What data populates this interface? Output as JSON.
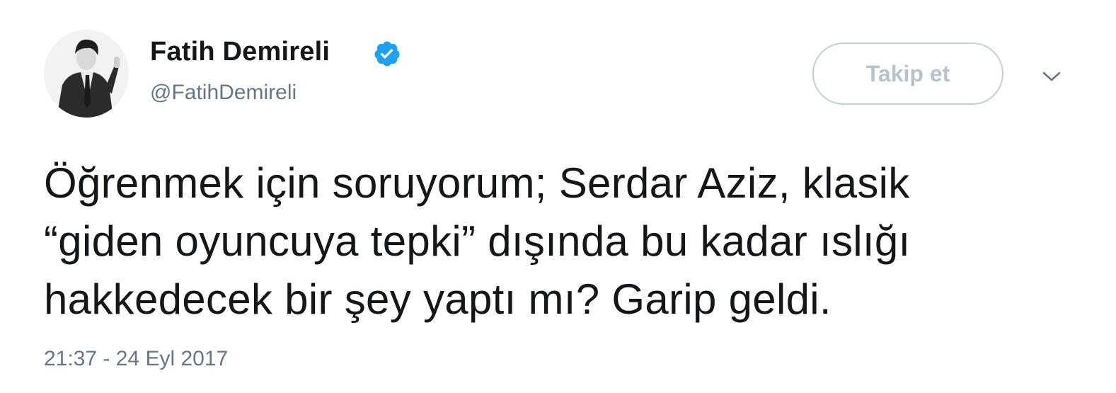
{
  "tweet": {
    "author": {
      "display_name": "Fatih Demireli",
      "handle": "@FatihDemireli",
      "verified": true
    },
    "follow_button_label": "Takip et",
    "text_lines": [
      "Öğrenmek için soruyorum; Serdar Aziz, klasik",
      "“giden oyuncuya tepki” dışında bu kadar ıslığı",
      "hakkedecek bir şey yaptı mı? Garip geldi."
    ],
    "timestamp": "21:37 - 24 Eyl 2017"
  },
  "colors": {
    "verified_badge": "#1da1f2",
    "secondary_text": "#657786",
    "follow_button_border": "#c4cfd6",
    "follow_button_text": "#b7c3cc"
  },
  "icons": {
    "verified": "verified-badge-icon",
    "caret": "chevron-down-icon"
  }
}
